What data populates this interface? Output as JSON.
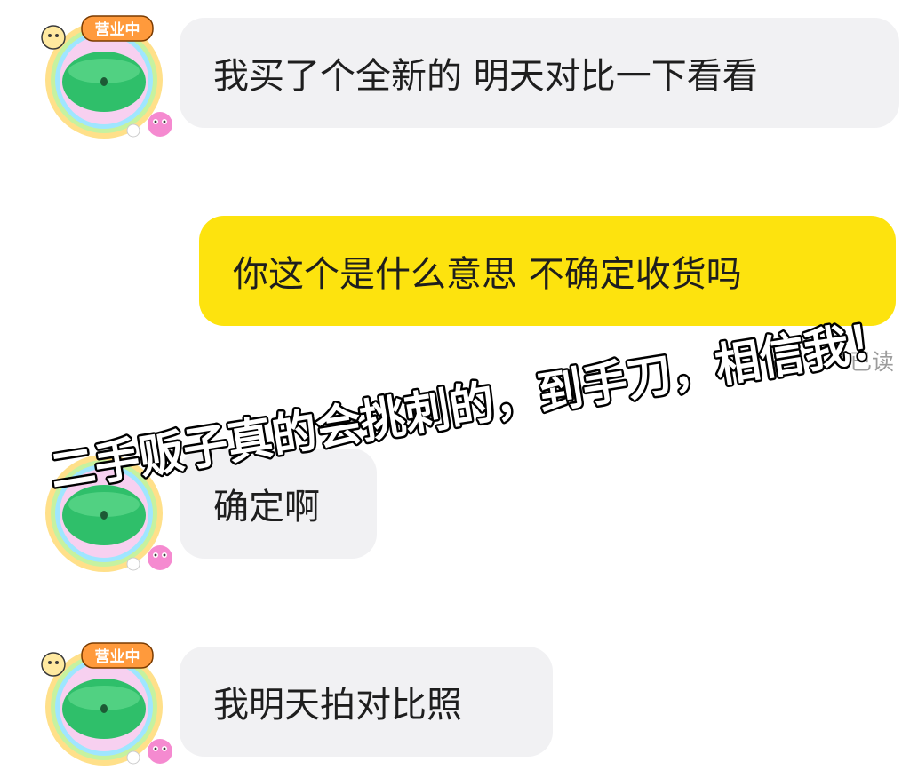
{
  "chat": {
    "messages": [
      {
        "sender": "other",
        "text": "我买了个全新的 明天对比一下看看"
      },
      {
        "sender": "self",
        "text": "你这个是什么意思 不确定收货吗"
      },
      {
        "sender": "other",
        "text": "确定啊"
      },
      {
        "sender": "other",
        "text": "我明天拍对比照"
      }
    ],
    "read_status": "已读"
  },
  "avatar": {
    "badge_text": "营业中",
    "ring_colors": [
      "#ffd54f",
      "#9fe6ff",
      "#f7a8e6",
      "#c6f2a0",
      "#ffe08a"
    ],
    "face_color": "#2fbf6a"
  },
  "overlay": {
    "caption": "二手贩子真的会挑刺的，到手刀，相信我！"
  },
  "colors": {
    "incoming_bubble": "#f1f1f3",
    "outgoing_bubble": "#fde30e",
    "read_status": "#9c9c9c"
  }
}
